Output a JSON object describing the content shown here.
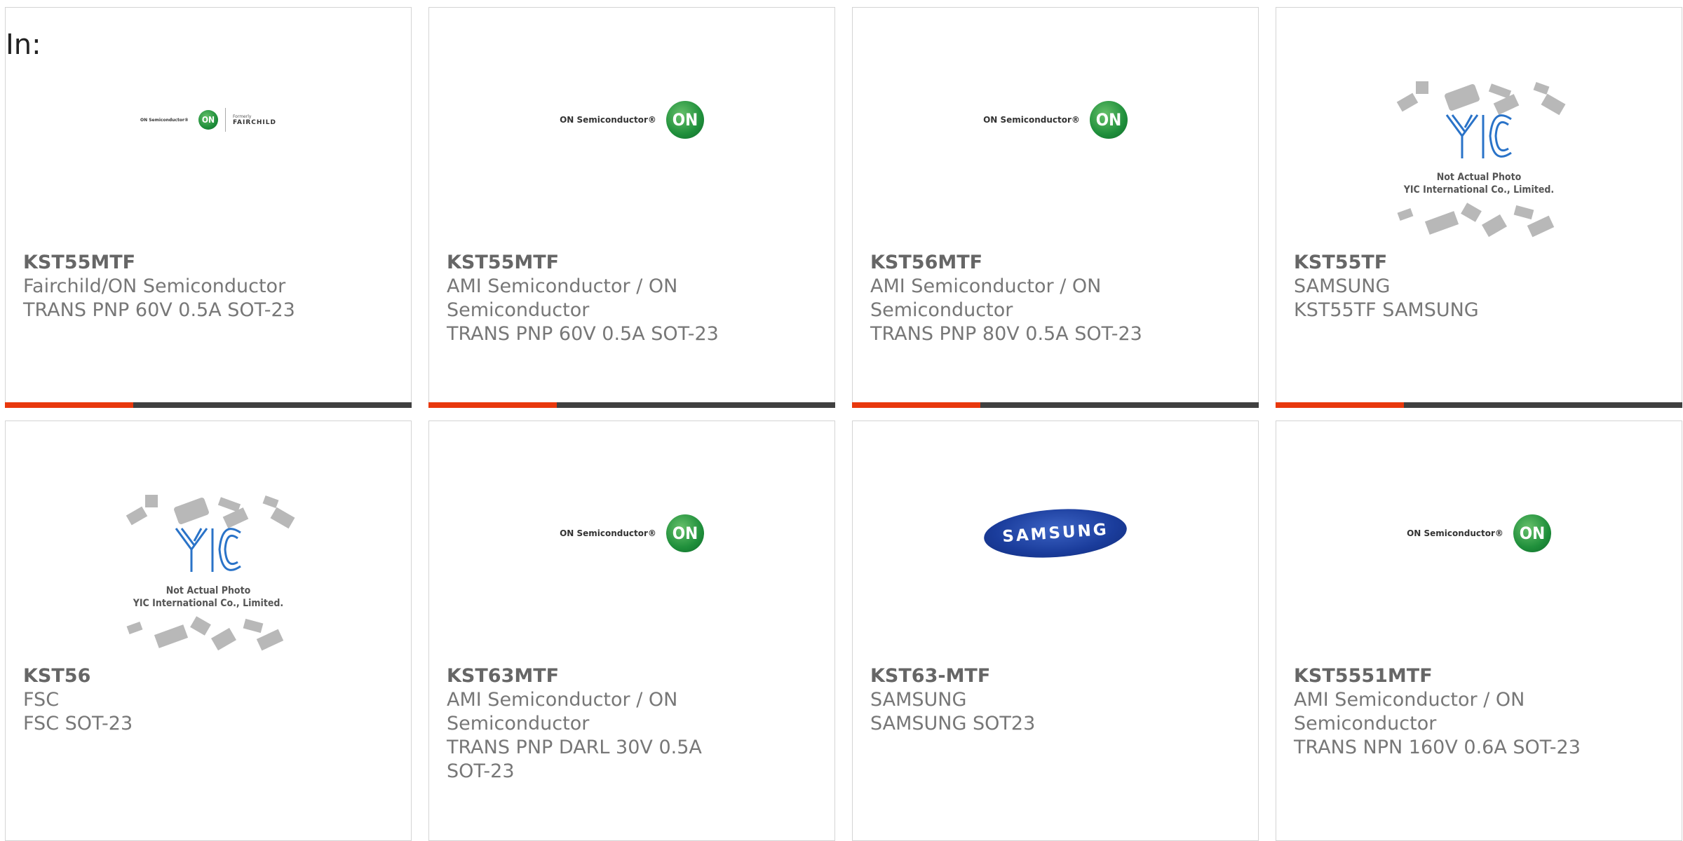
{
  "header": {
    "in_label": "In:"
  },
  "logos": {
    "onsemi_text": "ON Semiconductor®",
    "on_mark": "ON",
    "fairchild_formerly": "Formerly",
    "fairchild_name": "FAIRCHILD",
    "samsung": "SAMSUNG",
    "yic_line1": "Not Actual Photo",
    "yic_line2": "YIC International Co., Limited."
  },
  "colors": {
    "accent": "#e8380d",
    "bar": "#404040",
    "on_green": "#1f8f3b",
    "samsung_blue": "#1a3c9b",
    "yic_blue": "#2a73c8"
  },
  "products": [
    {
      "part": "KST55MTF",
      "mfr": "Fairchild/ON Semiconductor",
      "desc": "TRANS PNP 60V 0.5A SOT-23",
      "logo": "fairchild-onsemi-logo"
    },
    {
      "part": "KST55MTF",
      "mfr": "AMI Semiconductor / ON Semiconductor",
      "desc": "TRANS PNP 60V 0.5A SOT-23",
      "logo": "onsemi-logo"
    },
    {
      "part": "KST56MTF",
      "mfr": "AMI Semiconductor / ON Semiconductor",
      "desc": "TRANS PNP 80V 0.5A SOT-23",
      "logo": "onsemi-logo"
    },
    {
      "part": "KST55TF",
      "mfr": "SAMSUNG",
      "desc": "KST55TF SAMSUNG",
      "logo": "yic-placeholder"
    },
    {
      "part": "KST56",
      "mfr": "FSC",
      "desc": "FSC SOT-23",
      "logo": "yic-placeholder"
    },
    {
      "part": "KST63MTF",
      "mfr": "AMI Semiconductor / ON Semiconductor",
      "desc": "TRANS PNP DARL 30V 0.5A SOT-23",
      "logo": "onsemi-logo"
    },
    {
      "part": "KST63-MTF",
      "mfr": "SAMSUNG",
      "desc": "SAMSUNG SOT23",
      "logo": "samsung-logo"
    },
    {
      "part": "KST5551MTF",
      "mfr": "AMI Semiconductor / ON Semiconductor",
      "desc": "TRANS NPN 160V 0.6A SOT-23",
      "logo": "onsemi-logo"
    }
  ]
}
